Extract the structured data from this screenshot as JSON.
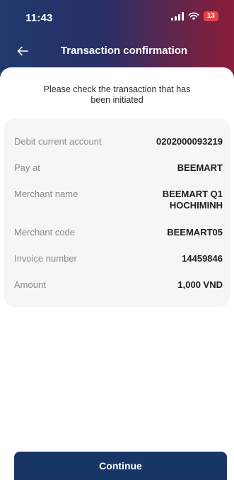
{
  "status_bar": {
    "time": "11:43",
    "battery": "13",
    "battery_color": "#e64545"
  },
  "nav": {
    "back_icon": "arrow-left-icon",
    "title": "Transaction confirmation"
  },
  "subtitle": "Please check the transaction that has been initiated",
  "details": [
    {
      "label": "Debit current account",
      "value": "0202000093219"
    },
    {
      "label": "Pay at",
      "value": "BEEMART"
    },
    {
      "label": "Merchant name",
      "value": "BEEMART Q1 HOCHIMINH"
    },
    {
      "label": "Merchant code",
      "value": "BEEMART05"
    },
    {
      "label": "Invoice number",
      "value": "14459846"
    },
    {
      "label": "Amount",
      "value": "1,000 VND"
    }
  ],
  "continue_label": "Continue",
  "colors": {
    "primary": "#173567",
    "header_gradient_start": "#1f3a6e",
    "header_gradient_end": "#8b1e3a"
  }
}
